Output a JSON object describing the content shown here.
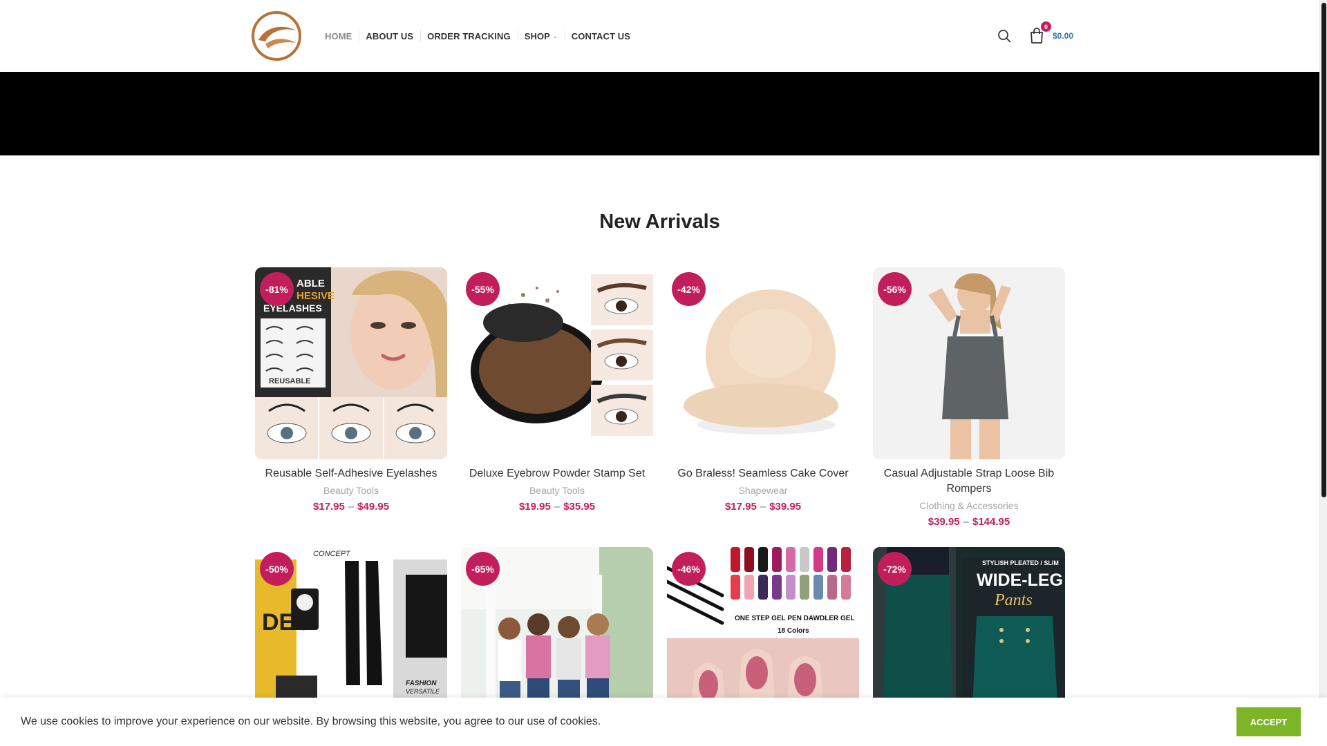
{
  "header": {
    "logo_icon": "brand-logo-icon",
    "nav": [
      {
        "label": "HOME",
        "active": true
      },
      {
        "label": "ABOUT US"
      },
      {
        "label": "ORDER TRACKING"
      },
      {
        "label": "SHOP",
        "has_dropdown": true
      },
      {
        "label": "CONTACT US"
      }
    ],
    "search_icon": "search-icon",
    "cart": {
      "icon": "shopping-bag-icon",
      "count": "0",
      "total": "$0.00"
    }
  },
  "section": {
    "title": "New Arrivals"
  },
  "products": [
    {
      "badge": "-81%",
      "title": "Reusable Self-Adhesive Eyelashes",
      "category": "Beauty Tools",
      "price_min": "$17.95",
      "price_max": "$49.95",
      "image_text": [
        "ABLE",
        "HESIVE",
        "EYELASHES",
        "REUSABLE"
      ]
    },
    {
      "badge": "-55%",
      "title": "Deluxe Eyebrow Powder Stamp Set",
      "category": "Beauty Tools",
      "price_min": "$19.95",
      "price_max": "$35.95"
    },
    {
      "badge": "-42%",
      "title": "Go Braless! Seamless Cake Cover",
      "category": "Shapewear",
      "price_min": "$17.95",
      "price_max": "$39.95"
    },
    {
      "badge": "-56%",
      "title": "Casual Adjustable Strap Loose Bib Rompers",
      "category": "Clothing & Accessories",
      "price_min": "$39.95",
      "price_max": "$144.95"
    },
    {
      "badge": "-50%",
      "image_text": [
        "CONCEPT",
        "DES",
        "FASHION",
        "VERSATILE"
      ]
    },
    {
      "badge": "-65%"
    },
    {
      "badge": "-46%",
      "image_text": [
        "ONE STEP GEL PEN DAWDLER GEL",
        "18 Colors"
      ]
    },
    {
      "badge": "-72%",
      "image_text": [
        "STYLISH PLEATED / SLIM",
        "WIDE-LEG",
        "Pants"
      ]
    }
  ],
  "cookies": {
    "text": "We use cookies to improve your experience on our website. By browsing this website, you agree to our use of cookies.",
    "accept_label": "ACCEPT"
  },
  "colors": {
    "accent": "#c21e5b",
    "accept": "#7cb526",
    "banner": "#000000",
    "cart_total": "#2f78b7"
  }
}
